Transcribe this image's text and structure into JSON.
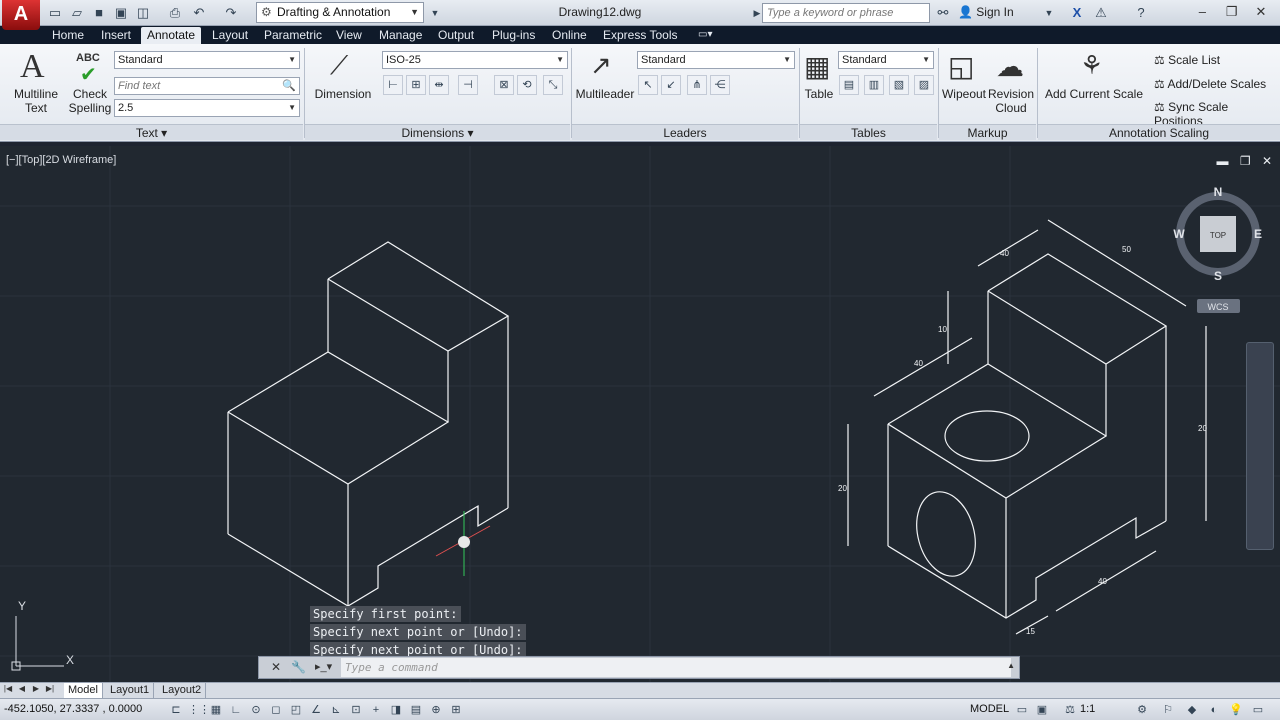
{
  "app": {
    "logo": "A",
    "workspace": "Drafting & Annotation",
    "doc_title": "Drawing12.dwg",
    "search_placeholder": "Type a keyword or phrase",
    "signin": "Sign In"
  },
  "tabs": [
    "Home",
    "Insert",
    "Annotate",
    "Layout",
    "Parametric",
    "View",
    "Manage",
    "Output",
    "Plug-ins",
    "Online",
    "Express Tools"
  ],
  "active_tab": "Annotate",
  "ribbon": {
    "text_panel": {
      "title": "Text",
      "multiline_label_1": "Multiline",
      "multiline_label_2": "Text",
      "check_label_1": "Check",
      "check_label_2": "Spelling",
      "abc": "ABC",
      "style": "Standard",
      "find_placeholder": "Find text",
      "height": "2.5"
    },
    "dimensions_panel": {
      "title": "Dimensions",
      "big_label": "Dimension",
      "style": "ISO-25"
    },
    "leaders_panel": {
      "title": "Leaders",
      "big_label": "Multileader",
      "style": "Standard"
    },
    "tables_panel": {
      "title": "Tables",
      "big_label": "Table",
      "style": "Standard"
    },
    "markup_panel": {
      "title": "Markup",
      "wipeout": "Wipeout",
      "revision_1": "Revision",
      "revision_2": "Cloud"
    },
    "annotation_scaling_panel": {
      "title": "Annotation Scaling",
      "add_current_scale": "Add Current Scale",
      "scale_list": "Scale List",
      "add_delete_scales": "Add/Delete Scales",
      "sync_scale_positions": "Sync Scale Positions"
    }
  },
  "viewport": {
    "label": "[−][Top][2D Wireframe]",
    "viewcube_top": "TOP",
    "compass_n": "N",
    "compass_s": "S",
    "compass_e": "E",
    "compass_w": "W",
    "wcs": "WCS",
    "ucs_y": "Y",
    "ucs_x": "X"
  },
  "command_history": [
    "Specify first point:",
    "Specify next point or [Undo]:",
    "Specify next point or [Undo]:"
  ],
  "command_placeholder": "Type a command",
  "layout_tabs": [
    "Model",
    "Layout1",
    "Layout2"
  ],
  "active_layout": "Model",
  "status": {
    "coords": "-452.1050, 27.3337 , 0.0000",
    "model": "MODEL",
    "scale": "1:1"
  },
  "dimension_labels": [
    "40",
    "50",
    "10",
    "40",
    "20",
    "20",
    "40",
    "15"
  ],
  "colors": {
    "drawing_bg": "#212830",
    "ribbon_tab_bg": "#0f1a2a",
    "accent_red": "#c81e1e"
  }
}
